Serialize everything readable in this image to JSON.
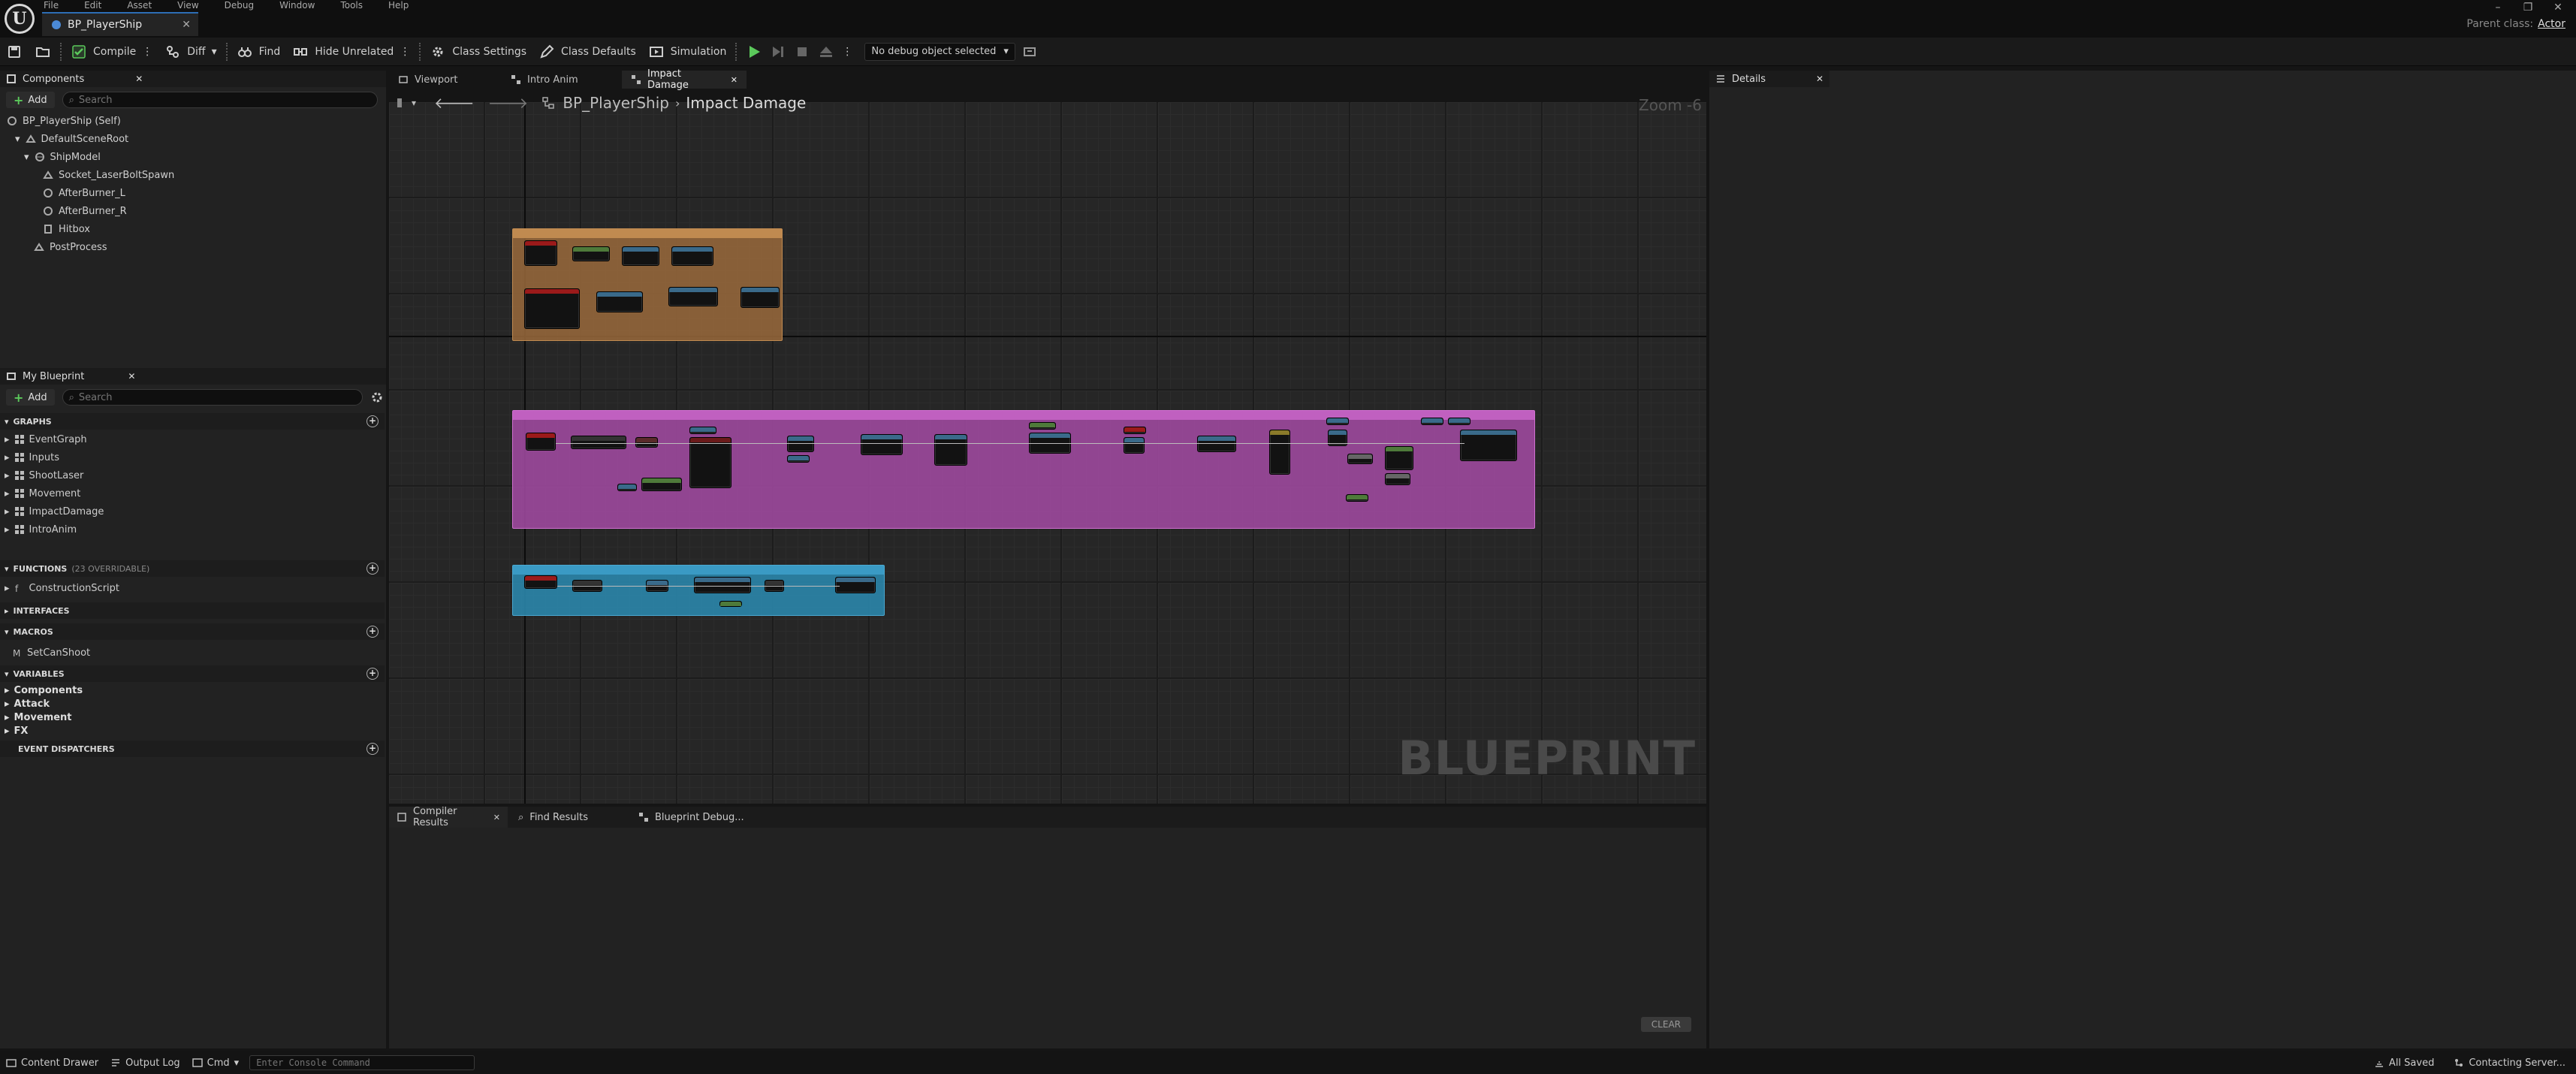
{
  "window": {
    "menu": [
      "File",
      "Edit",
      "Asset",
      "View",
      "Debug",
      "Window",
      "Tools",
      "Help"
    ],
    "document_tab": "BP_PlayerShip",
    "parent_class_label": "Parent class:",
    "parent_class_value": "Actor"
  },
  "toolbar": {
    "compile": "Compile",
    "diff": "Diff",
    "find": "Find",
    "hide_unrelated": "Hide Unrelated",
    "class_settings": "Class Settings",
    "class_defaults": "Class Defaults",
    "simulation": "Simulation",
    "debug_object": "No debug object selected"
  },
  "components": {
    "title": "Components",
    "add": "Add",
    "search_placeholder": "Search",
    "items": [
      "BP_PlayerShip (Self)",
      "DefaultSceneRoot",
      "ShipModel",
      "Socket_LaserBoltSpawn",
      "AfterBurner_L",
      "AfterBurner_R",
      "Hitbox",
      "PostProcess"
    ]
  },
  "my_blueprint": {
    "title": "My Blueprint",
    "add": "Add",
    "search_placeholder": "Search",
    "graphs_header": "GRAPHS",
    "graphs": [
      "EventGraph",
      "Inputs",
      "ShootLaser",
      "Movement",
      "ImpactDamage",
      "IntroAnim"
    ],
    "functions_header": "FUNCTIONS",
    "functions_overridable": "(23 OVERRIDABLE)",
    "functions": [
      "ConstructionScript"
    ],
    "interfaces_header": "INTERFACES",
    "macros_header": "MACROS",
    "macros": [
      "SetCanShoot"
    ],
    "variables_header": "VARIABLES",
    "variables": [
      "Components",
      "Attack",
      "Movement",
      "FX"
    ],
    "dispatchers_header": "EVENT DISPATCHERS"
  },
  "graph_tabs": [
    "Viewport",
    "Intro Anim",
    "Impact Damage"
  ],
  "breadcrumb": {
    "root": "BP_PlayerShip",
    "current": "Impact Damage"
  },
  "zoom": "Zoom -6",
  "watermark": "BLUEPRINT",
  "details_title": "Details",
  "bottom_tabs": [
    "Compiler Results",
    "Find Results",
    "Blueprint Debug..."
  ],
  "clear": "CLEAR",
  "status": {
    "content_drawer": "Content Drawer",
    "output_log": "Output Log",
    "cmd": "Cmd",
    "console_placeholder": "Enter Console Command",
    "all_saved": "All Saved",
    "source_control": "Contacting Server..."
  },
  "colors": {
    "comment_orange": "#9a6a3c",
    "comment_magenta": "#a04aa0",
    "comment_teal": "#2b86ab",
    "accent_blue": "#2d6db5"
  }
}
